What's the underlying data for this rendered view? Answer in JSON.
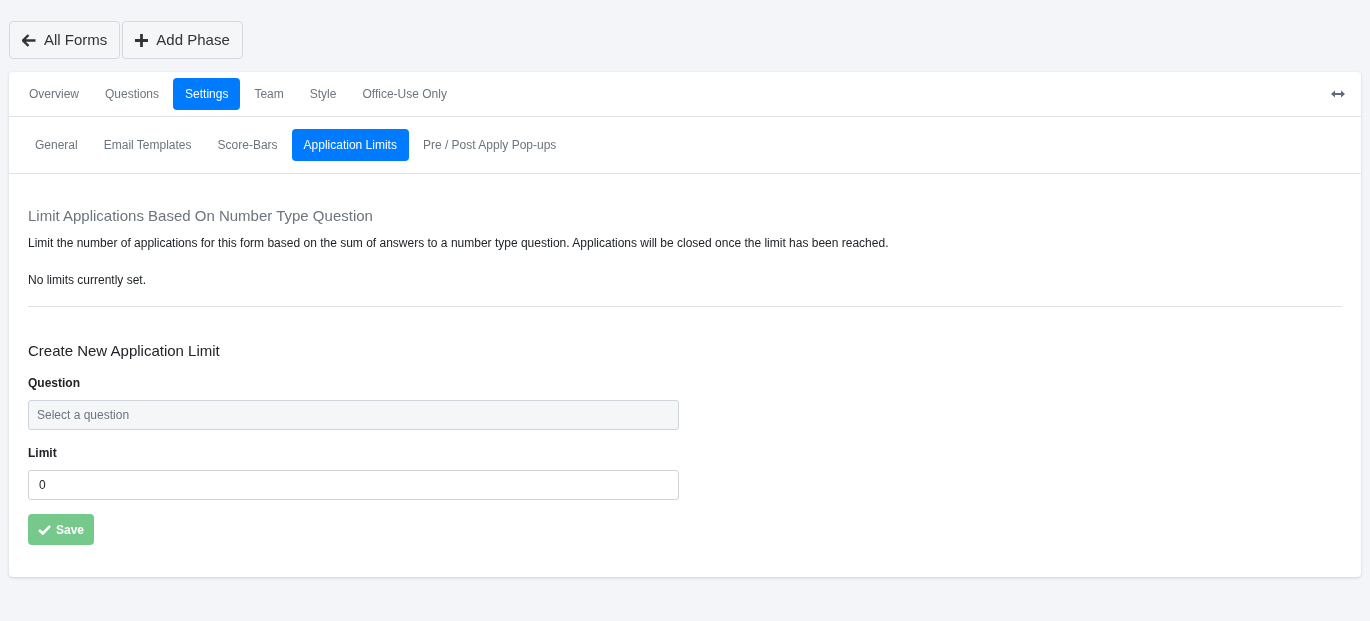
{
  "toolbar": {
    "buttons": [
      {
        "label": "All Forms",
        "kind": "back"
      },
      {
        "label": "Add Phase",
        "kind": "add"
      }
    ]
  },
  "tabs": [
    {
      "label": "Overview",
      "selected": false
    },
    {
      "label": "Questions",
      "selected": false
    },
    {
      "label": "Settings",
      "selected": true
    },
    {
      "label": "Team",
      "selected": false
    },
    {
      "label": "Style",
      "selected": false
    },
    {
      "label": "Office-Use Only",
      "selected": false
    }
  ],
  "subtabs": [
    {
      "label": "General",
      "selected": false
    },
    {
      "label": "Email Templates",
      "selected": false
    },
    {
      "label": "Score-Bars",
      "selected": false
    },
    {
      "label": "Application Limits",
      "selected": true
    },
    {
      "label": "Pre / Post Apply Pop-ups",
      "selected": false
    }
  ],
  "section": {
    "title": "Limit Applications Based On Number Type Question",
    "description": "Limit the number of applications for this form based on the sum of answers to a number type question. Applications will be closed once the limit has been reached.",
    "status": "No limits currently set."
  },
  "form": {
    "title": "Create New Application Limit",
    "fields": [
      {
        "label": "Question",
        "kind": "select",
        "placeholder": "Select a question"
      },
      {
        "label": "Limit",
        "kind": "number",
        "value": "0"
      }
    ],
    "save_button": {
      "label": "Save",
      "disabled": true
    }
  }
}
